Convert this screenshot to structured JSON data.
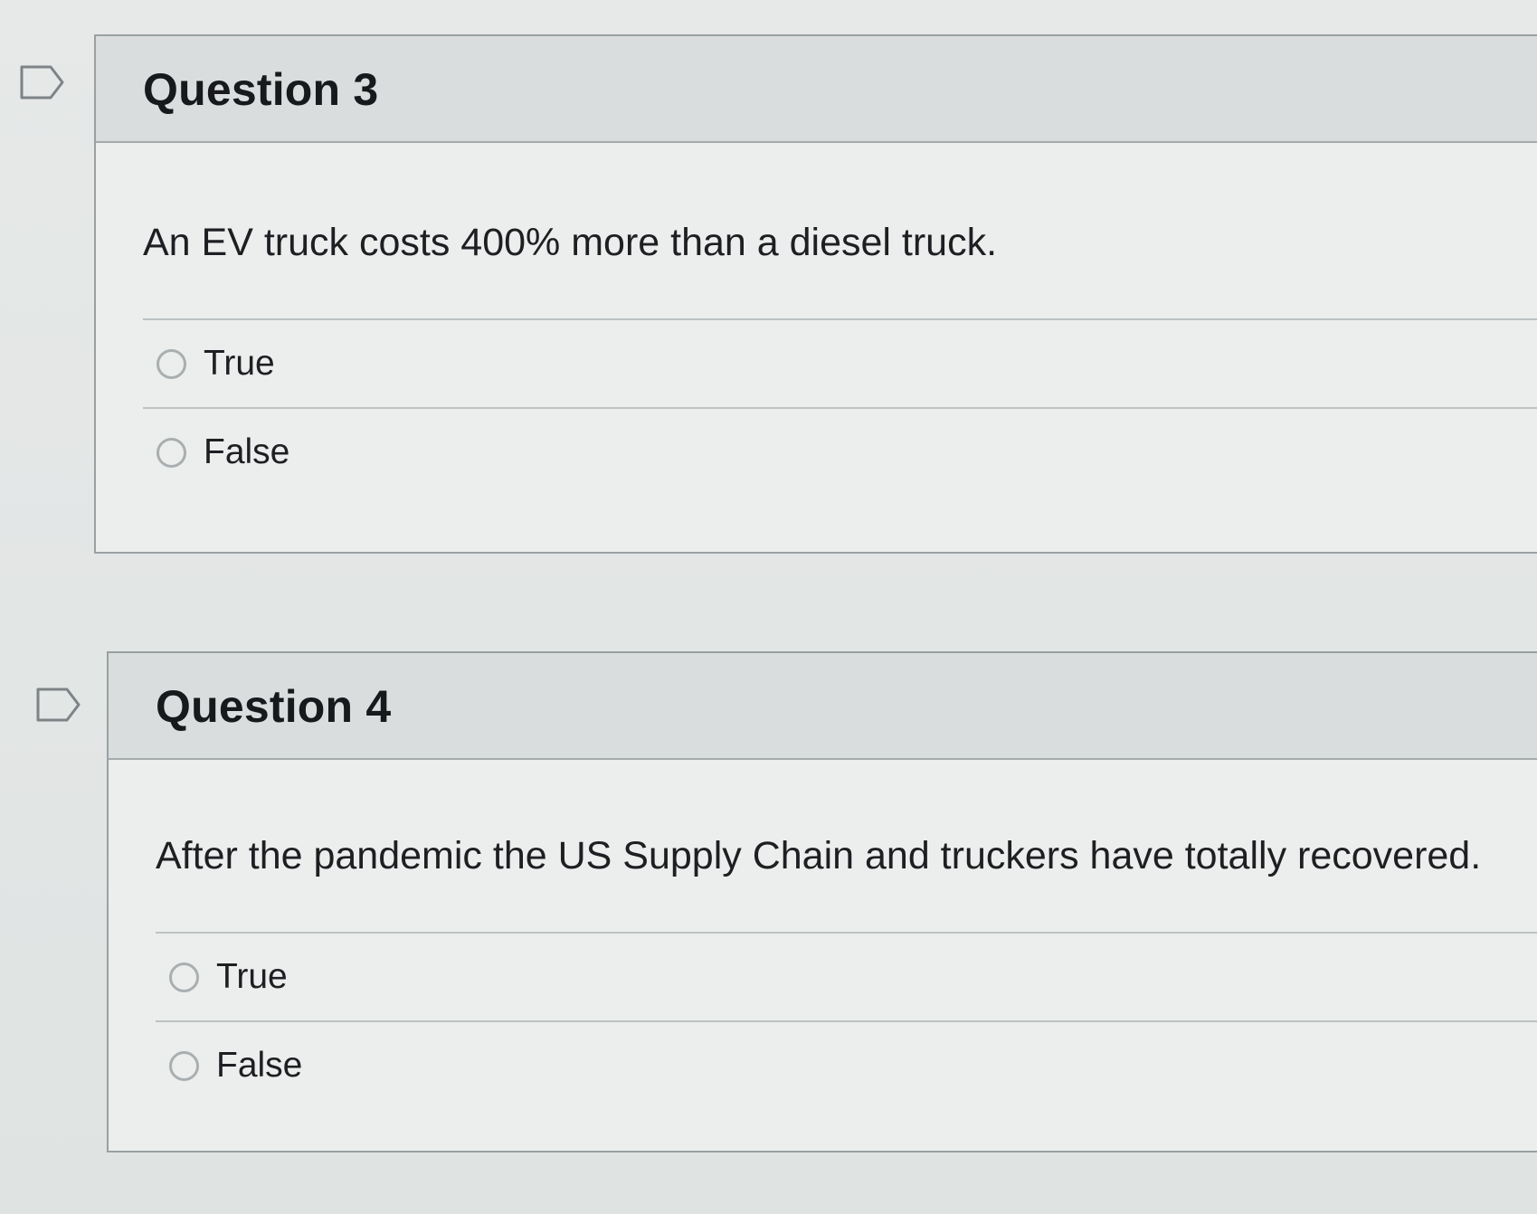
{
  "questions": [
    {
      "title": "Question 3",
      "text": "An EV truck costs 400% more than a diesel truck.",
      "options": [
        "True",
        "False"
      ],
      "flag_icon": "bookmark-flag-icon"
    },
    {
      "title": "Question 4",
      "text": "After the pandemic the US Supply Chain and truckers have  totally recovered.",
      "options": [
        "True",
        "False"
      ],
      "flag_icon": "bookmark-flag-icon"
    }
  ],
  "colors": {
    "background": "#e4e7e6",
    "header": "#d9dddd",
    "border": "#9aa0a2",
    "text": "#1d1f22"
  }
}
